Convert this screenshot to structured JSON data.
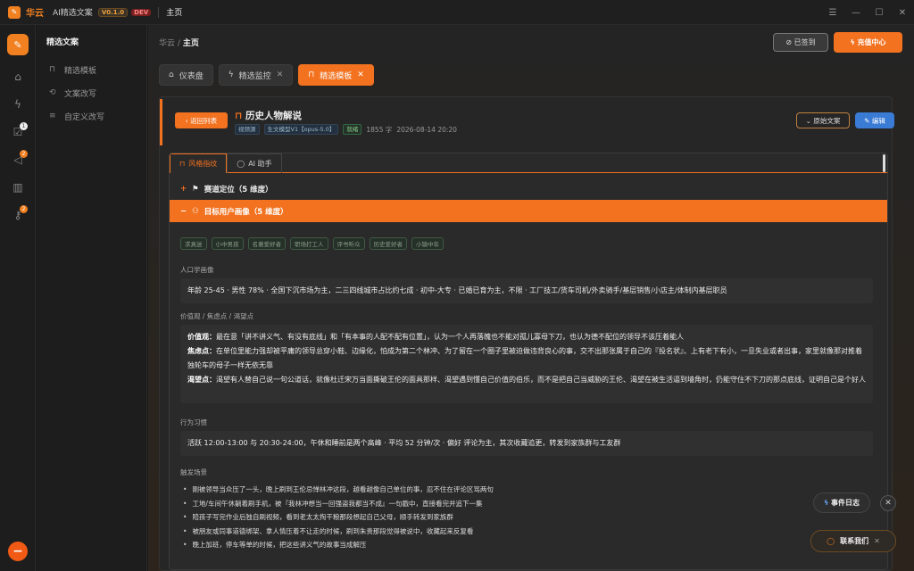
{
  "titlebar": {
    "brand": "华云",
    "app": "AI精选文案",
    "version": "V0.1.0",
    "env": "DEV",
    "page": "主页",
    "controls": [
      "☰",
      "—",
      "☐",
      "✕"
    ]
  },
  "rail": {
    "badges": {
      "publish": "1",
      "notice": "2",
      "tools": "2"
    }
  },
  "side": {
    "title": "精选文案",
    "items": [
      {
        "label": "精选模板",
        "icon": "bookmark-icon"
      },
      {
        "label": "文案改写",
        "icon": "rewrite-icon"
      },
      {
        "label": "自定义改写",
        "icon": "sliders-icon"
      }
    ]
  },
  "crumb": {
    "root": "华云",
    "sep": "/",
    "current": "主页"
  },
  "top": {
    "signed": "已签到",
    "charge": "充值中心"
  },
  "tabs": [
    {
      "label": "仪表盘",
      "icon": "home-icon"
    },
    {
      "label": "精选监控",
      "icon": "bolt-icon"
    },
    {
      "label": "精选模板",
      "icon": "bookmark-icon"
    }
  ],
  "header": {
    "back": "返回列表",
    "title": "历史人物解说",
    "tag1": "视频源",
    "tag2": "生文模型V1【opus-5.0】",
    "tag3": "就绪",
    "words": "1855 字",
    "time": "2026-08-14 20:20",
    "orig": "原始文案",
    "edit": "编辑"
  },
  "inner": {
    "tab1": "风格指纹",
    "tab2": "AI 助手",
    "sec1": "赛道定位（5 维度）",
    "sec2": "目标用户画像（5 维度）"
  },
  "chips": [
    "求真迷",
    "小中男孩",
    "名著爱好者",
    "职场打工人",
    "评书听众",
    "历史爱好者",
    "小镇中年"
  ],
  "persona": {
    "label": "人口学画像",
    "text": "年龄 25-45 · 男性 78% · 全国下沉市场为主，二三四线城市占比约七成 · 初中-大专 · 已婚已育为主，不限 · 工厂技工/货车司机/外卖骑手/基层销售/小店主/体制内基层职员"
  },
  "values": {
    "label": "价值观 / 焦虑点 / 渴望点",
    "v_k": "价值观：",
    "v": "最在意「讲不讲义气、有没有底线」和「有本事的人配不配有位置」，认为一个人再落魄也不能对孤儿寡母下刀，也认为德不配位的领导不该压着能人",
    "a_k": "焦虑点：",
    "a": "在单位里能力强却被平庸的领导总穿小鞋、边缘化，怕成为第二个林冲、为了留在一个圈子里被迫做违背良心的事，交不出那张属于自己的『投名状』、上有老下有小，一旦失业或者出事，家里就像那对推着独轮车的母子一样无依无靠",
    "d_k": "渴望点：",
    "d": "渴望有人替自己说一句公道话，就像杜迁宋万当面撕破王伦的面具那样、渴望遇到懂自己价值的伯乐，而不是把自己当威胁的王伦、渴望在被生活逼到墙角时，仍能守住不下刀的那点底线，证明自己是个好人"
  },
  "habit": {
    "label": "行为习惯",
    "text": "活跃 12:00-13:00 与 20:30-24:00，午休和睡前是两个高峰 · 平均 52 分钟/次 · 偏好 评论为主，其次收藏追更，转发到家族群与工友群"
  },
  "trigger": {
    "label": "触发场景",
    "items": [
      "刚被领导当众压了一头，晚上刷到王伦忌惮林冲这段，越看越像自己单位的事，忍不住在评论区骂两句",
      "工地/车间午休躺着刷手机，被『我林冲想当一回强盗我都当不成』一句戳中，直接看完并追下一集",
      "陪孩子写完作业后独自刷视频，看到老太太掏干粮那段想起自己父母，顺手转发到家族群",
      "被朋友或同事道德绑架、拿人情压着不让走的时候，刷到朱贵那段觉得被说中，收藏起来反复看",
      "晚上加班，停车等单的时候，把这些讲义气的故事当成解压"
    ]
  },
  "float": {
    "events": "事件日志",
    "contact": "联系我们"
  }
}
